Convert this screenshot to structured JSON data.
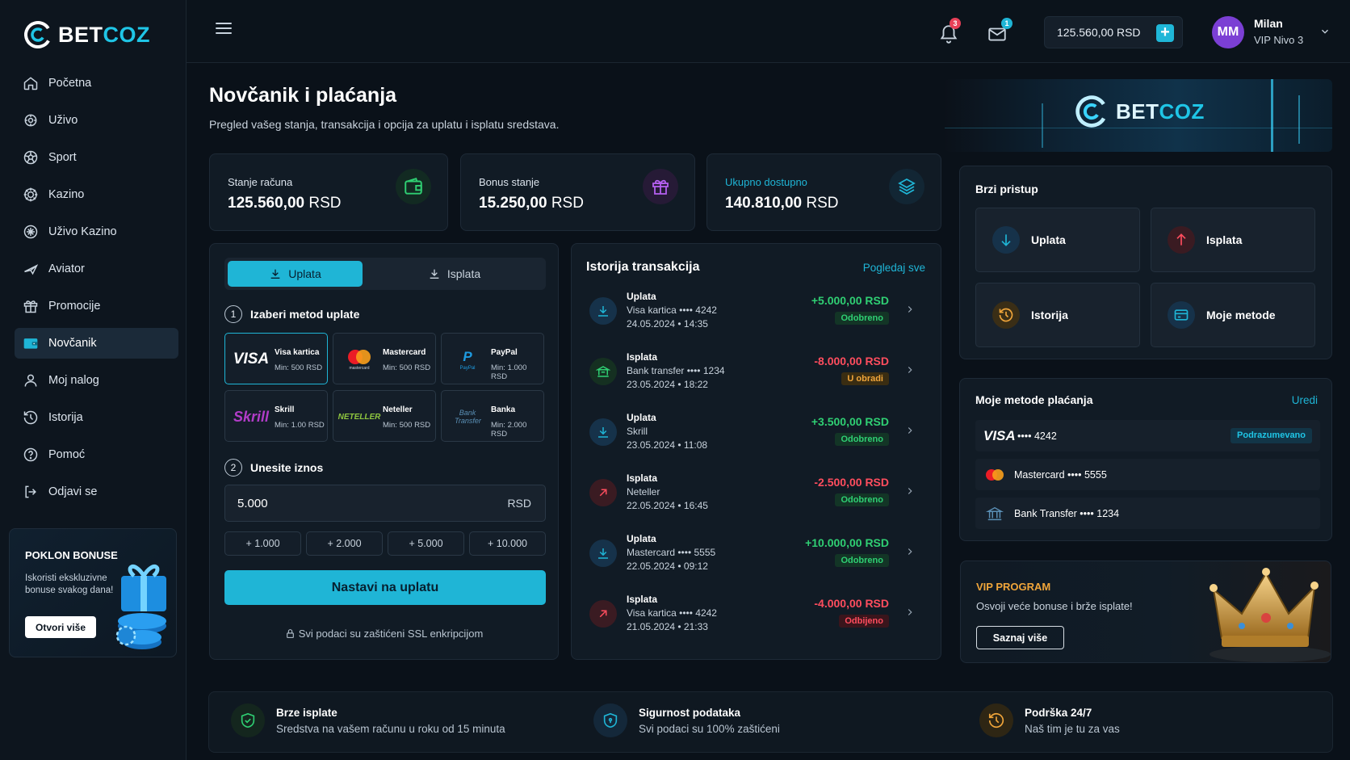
{
  "brand": {
    "name_a": "BET",
    "name_b": "COZ"
  },
  "sidebar": {
    "items": [
      {
        "label": "Početna",
        "icon": "home-icon"
      },
      {
        "label": "Uživo",
        "icon": "live-icon"
      },
      {
        "label": "Sport",
        "icon": "soccer-ball-icon"
      },
      {
        "label": "Kazino",
        "icon": "casino-chip-icon"
      },
      {
        "label": "Uživo Kazino",
        "icon": "live-casino-icon"
      },
      {
        "label": "Aviator",
        "icon": "plane-icon"
      },
      {
        "label": "Promocije",
        "icon": "gift-icon"
      },
      {
        "label": "Novčanik",
        "icon": "wallet-icon",
        "active": true
      },
      {
        "label": "Moj nalog",
        "icon": "user-icon"
      },
      {
        "label": "Istorija",
        "icon": "history-icon"
      },
      {
        "label": "Pomoć",
        "icon": "help-icon"
      },
      {
        "label": "Odjavi se",
        "icon": "logout-icon"
      }
    ],
    "promo": {
      "title": "POKLON BONUSE",
      "text": "Iskoristi ekskluzivne bonuse svakog dana!",
      "button": "Otvori više"
    }
  },
  "topbar": {
    "notif_count": "3",
    "mail_count": "1",
    "balance": "125.560,00 RSD",
    "user": {
      "initials": "MM",
      "name": "Milan",
      "level": "VIP Nivo 3"
    }
  },
  "header": {
    "title": "Novčanik i plaćanja",
    "subtitle": "Pregled vašeg stanja, transakcija i opcija za uplatu i isplatu sredstava."
  },
  "stats": [
    {
      "label": "Stanje računa",
      "value": "125.560,00",
      "currency": "RSD",
      "icon": "wallet-icon",
      "color": "#2fcf73"
    },
    {
      "label": "Bonus stanje",
      "value": "15.250,00",
      "currency": "RSD",
      "icon": "gift-icon",
      "color": "#b560f0"
    },
    {
      "label": "Ukupno dostupno",
      "value": "140.810,00",
      "currency": "RSD",
      "icon": "layers-icon",
      "color": "#1fb5d6"
    }
  ],
  "deposit": {
    "tab_deposit": "Uplata",
    "tab_withdraw": "Isplata",
    "step1_num": "1",
    "step1": "Izaberi metod uplate",
    "methods": [
      {
        "name": "Visa kartica",
        "min": "Min: 500 RSD",
        "logo": "VISA"
      },
      {
        "name": "Mastercard",
        "min": "Min: 500 RSD",
        "logo": "mastercard"
      },
      {
        "name": "PayPal",
        "min": "Min: 1.000 RSD",
        "logo": "PayPal"
      },
      {
        "name": "Skrill",
        "min": "Min: 1.00 RSD",
        "logo": "Skrill"
      },
      {
        "name": "Neteller",
        "min": "Min: 500 RSD",
        "logo": "NETELLER"
      },
      {
        "name": "Banka",
        "min": "Min: 2.000 RSD",
        "logo": "Bank Transfer"
      }
    ],
    "step2_num": "2",
    "step2": "Unesite iznos",
    "amount": "5.000",
    "currency": "RSD",
    "quick": [
      "+ 1.000",
      "+ 2.000",
      "+ 5.000",
      "+ 10.000"
    ],
    "cta": "Nastavi na uplatu",
    "ssl": "Svi podaci su zaštićeni SSL enkripcijom"
  },
  "transactions": {
    "title": "Istorija transakcija",
    "link": "Pogledaj sve",
    "items": [
      {
        "type": "Uplata",
        "method": "Visa kartica •••• 4242",
        "date": "24.05.2024 • 14:35",
        "amount": "+5.000,00 RSD",
        "status": "Odobreno",
        "kind": "in",
        "status_kind": "ok"
      },
      {
        "type": "Isplata",
        "method": "Bank transfer •••• 1234",
        "date": "23.05.2024 • 18:22",
        "amount": "-8.000,00 RSD",
        "status": "U obradi",
        "kind": "out-bank",
        "status_kind": "pending"
      },
      {
        "type": "Uplata",
        "method": "Skrill",
        "date": "23.05.2024 • 11:08",
        "amount": "+3.500,00 RSD",
        "status": "Odobreno",
        "kind": "in",
        "status_kind": "ok"
      },
      {
        "type": "Isplata",
        "method": "Neteller",
        "date": "22.05.2024 • 16:45",
        "amount": "-2.500,00 RSD",
        "status": "Odobreno",
        "kind": "out",
        "status_kind": "ok"
      },
      {
        "type": "Uplata",
        "method": "Mastercard •••• 5555",
        "date": "22.05.2024 • 09:12",
        "amount": "+10.000,00 RSD",
        "status": "Odobreno",
        "kind": "in",
        "status_kind": "ok"
      },
      {
        "type": "Isplata",
        "method": "Visa kartica •••• 4242",
        "date": "21.05.2024 • 21:33",
        "amount": "-4.000,00 RSD",
        "status": "Odbijeno",
        "kind": "out",
        "status_kind": "rejected"
      }
    ]
  },
  "quick_access": {
    "title": "Brzi pristup",
    "items": [
      {
        "label": "Uplata",
        "icon": "arrow-down-icon"
      },
      {
        "label": "Isplata",
        "icon": "arrow-up-icon"
      },
      {
        "label": "Istorija",
        "icon": "history-icon"
      },
      {
        "label": "Moje metode",
        "icon": "card-icon"
      }
    ]
  },
  "my_methods": {
    "title": "Moje metode plaćanja",
    "edit": "Uredi",
    "items": [
      {
        "logo": "VISA",
        "label": "•••• 4242",
        "badge": "Podrazumevano"
      },
      {
        "logo": "mastercard",
        "label": "Mastercard •••• 5555"
      },
      {
        "logo": "bank",
        "label": "Bank Transfer •••• 1234"
      }
    ]
  },
  "vip": {
    "title": "VIP PROGRAM",
    "text": "Osvoji veće bonuse i brže isplate!",
    "button": "Saznaj više"
  },
  "features": [
    {
      "title": "Brze isplate",
      "sub": "Sredstva na vašem računu u roku od 15 minuta",
      "icon": "shield-check-icon"
    },
    {
      "title": "Sigurnost podataka",
      "sub": "Svi podaci su 100% zaštićeni",
      "icon": "shield-icon"
    },
    {
      "title": "Podrška 24/7",
      "sub": "Naš tim je tu za vas",
      "icon": "clock-icon"
    }
  ],
  "colors": {
    "accent": "#1fb5d6",
    "positive": "#2fcf73",
    "negative": "#ff4d5e",
    "pending": "#f0a53a",
    "bg": "#0a1119"
  }
}
